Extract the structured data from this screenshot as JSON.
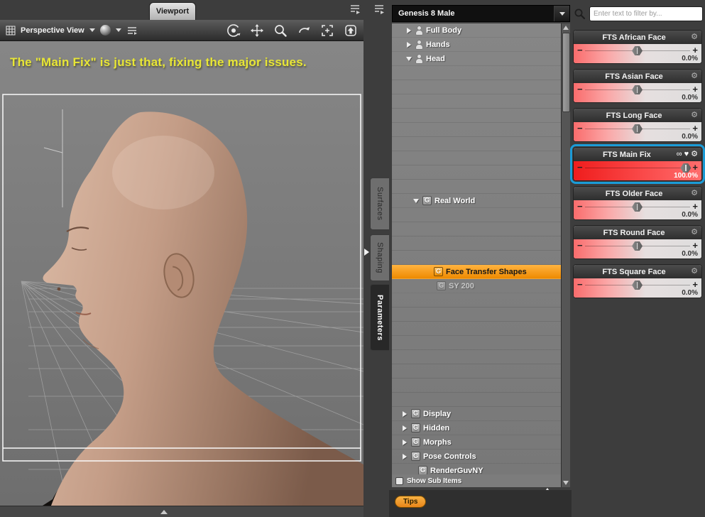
{
  "colors": {
    "accent_orange": "#f08c00",
    "selection_blue": "#1b9bd7",
    "slider_red": "#f94646",
    "caption_yellow": "#e8e636"
  },
  "icons": {
    "gear": "⚙",
    "heart": "♥",
    "link": "∞",
    "minus": "−",
    "plus": "+",
    "dropdown": "▼",
    "search": "magnifier"
  },
  "viewport": {
    "tab_label": "Viewport",
    "view_mode": "Perspective View",
    "caption": "The \"Main Fix\" is just that, fixing the major issues."
  },
  "side_tabs": {
    "surfaces": "Surfaces",
    "shaping": "Shaping",
    "parameters": "Parameters",
    "active": "Parameters"
  },
  "parameters_panel": {
    "figure_selector": "Genesis 8 Male",
    "search_placeholder": "Enter text to filter by...",
    "show_sub_items_label": "Show Sub Items",
    "tips_label": "Tips",
    "tree_items": [
      {
        "label": "Full Body",
        "arrow": "right",
        "icon": "figure",
        "indent": 20
      },
      {
        "label": "Hands",
        "arrow": "right",
        "icon": "figure",
        "indent": 20
      },
      {
        "label": "Head",
        "arrow": "down",
        "icon": "figure",
        "indent": 20,
        "gap_after": 180
      },
      {
        "label": "Real World",
        "arrow": "down",
        "icon": "group",
        "indent": 30,
        "gap_after": 80
      },
      {
        "label": "Face Transfer Shapes",
        "arrow": "none",
        "icon": "group",
        "indent": 46,
        "selected": true
      },
      {
        "label": "SY 200",
        "arrow": "none",
        "icon": "group",
        "indent": 50,
        "dim": true,
        "gap_after": 160
      },
      {
        "label": "Display",
        "arrow": "right",
        "icon": "group",
        "indent": 14
      },
      {
        "label": "Hidden",
        "arrow": "right",
        "icon": "group",
        "indent": 14
      },
      {
        "label": "Morphs",
        "arrow": "right",
        "icon": "group",
        "indent": 14
      },
      {
        "label": "Pose Controls",
        "arrow": "right",
        "icon": "group",
        "indent": 14
      },
      {
        "label": "RenderGuvNY",
        "arrow": "none",
        "icon": "group",
        "indent": 24
      }
    ],
    "sliders": [
      {
        "label": "FTS African Face",
        "value": "0.0%",
        "thumb_percent": 50,
        "title_icons": [
          "gear"
        ]
      },
      {
        "label": "FTS Asian Face",
        "value": "0.0%",
        "thumb_percent": 50,
        "title_icons": [
          "gear"
        ]
      },
      {
        "label": "FTS Long Face",
        "value": "0.0%",
        "thumb_percent": 50,
        "title_icons": [
          "gear"
        ]
      },
      {
        "label": "FTS Main Fix",
        "value": "100.0%",
        "thumb_percent": 88,
        "selected": true,
        "title_icons": [
          "link",
          "heart",
          "gear"
        ]
      },
      {
        "label": "FTS Older Face",
        "value": "0.0%",
        "thumb_percent": 50,
        "title_icons": [
          "gear"
        ]
      },
      {
        "label": "FTS Round Face",
        "value": "0.0%",
        "thumb_percent": 50,
        "title_icons": [
          "gear"
        ]
      },
      {
        "label": "FTS Square Face",
        "value": "0.0%",
        "thumb_percent": 50,
        "title_icons": [
          "gear"
        ]
      }
    ]
  }
}
